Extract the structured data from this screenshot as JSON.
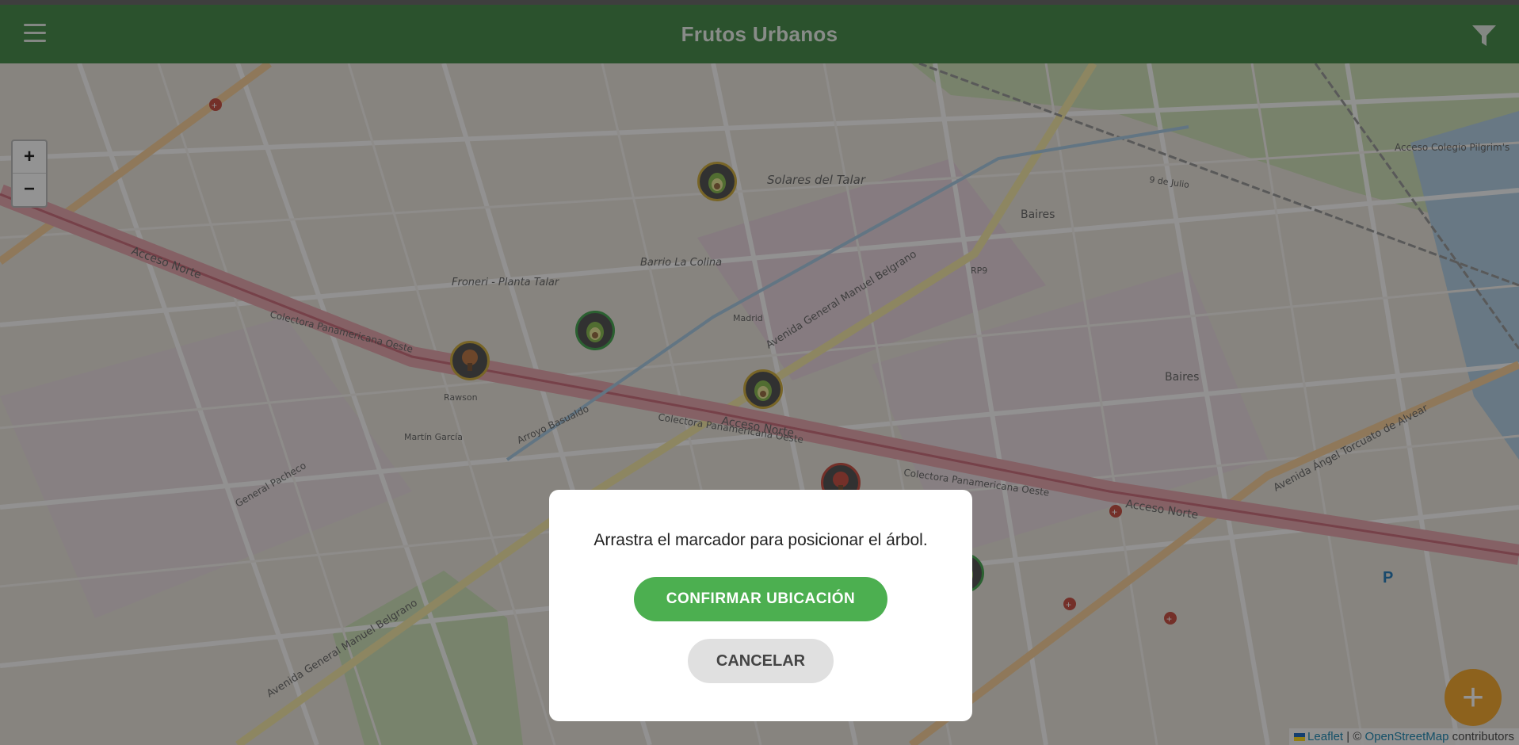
{
  "app": {
    "title": "Frutos Urbanos",
    "menu_icon": "hamburger-menu-icon",
    "filter_icon": "filter-funnel-icon"
  },
  "map": {
    "zoom_in_label": "+",
    "zoom_out_label": "−",
    "street_labels": [
      "Acceso Norte",
      "Colectora Panamericana Oeste",
      "Avenida General Manuel Belgrano",
      "Solares del Talar",
      "Barrio La Colina",
      "Froneri - Planta Talar",
      "Baires",
      "Avenida Ángel Torcuato de Alvear",
      "Arroyo Basualdo",
      "RP9",
      "Acceso Colegio Pilgrim's",
      "Madrid",
      "Rawson",
      "Martín García",
      "General Pacheco",
      "9 de Julio"
    ],
    "markers": [
      {
        "type": "avocado",
        "status": "yellow"
      },
      {
        "type": "avocado",
        "status": "green"
      },
      {
        "type": "tree",
        "status": "yellow"
      },
      {
        "type": "avocado",
        "status": "yellow"
      },
      {
        "type": "tree",
        "status": "red"
      },
      {
        "type": "avocado",
        "status": "green"
      }
    ],
    "fab_label": "+",
    "attribution": {
      "leaflet": "Leaflet",
      "separator": " | © ",
      "osm": "OpenStreetMap",
      "suffix": " contributors"
    }
  },
  "modal": {
    "message": "Arrastra el marcador para posicionar el árbol.",
    "confirm_label": "CONFIRMAR UBICACIÓN",
    "cancel_label": "CANCELAR"
  },
  "colors": {
    "header": "#2e7d32",
    "confirm": "#4caf50",
    "cancel": "#e0e0e0",
    "fab": "#f39c12"
  }
}
